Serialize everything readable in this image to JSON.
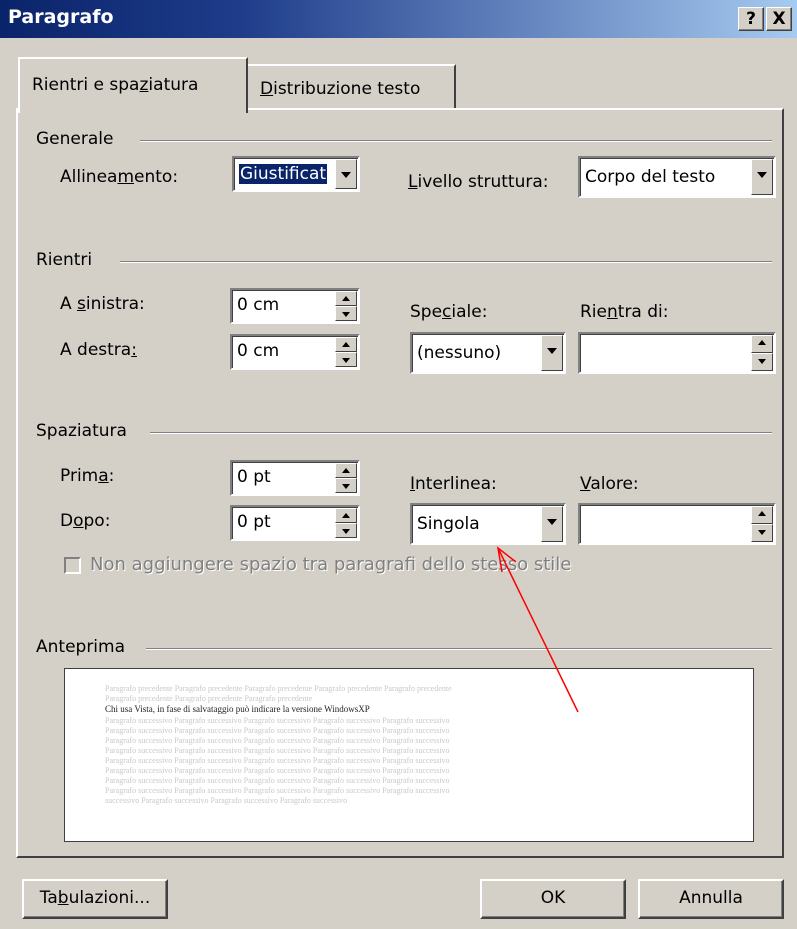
{
  "window": {
    "title": "Paragrafo",
    "help_label": "?",
    "close_label": "X"
  },
  "tabs": [
    {
      "label_pre": "Rientri e spa",
      "label_key": "z",
      "label_post": "iatura",
      "active": true
    },
    {
      "label_pre": "",
      "label_key": "D",
      "label_post": "istribuzione testo",
      "active": false
    }
  ],
  "generale": {
    "group_label": "Generale",
    "alignment_label_pre": "Allinea",
    "alignment_label_key": "m",
    "alignment_label_post": "ento:",
    "alignment_value": "Giustificat",
    "outline_label_pre": "",
    "outline_label_key": "L",
    "outline_label_post": "ivello struttura:",
    "outline_value": "Corpo del testo"
  },
  "rientri": {
    "group_label": "Rientri",
    "left_label_pre": "A ",
    "left_label_key": "s",
    "left_label_post": "inistra:",
    "left_value": "0 cm",
    "right_label_pre": "A destra",
    "right_label_key": ":",
    "right_label_post": "",
    "right_value": "0 cm",
    "special_label_pre": "Spe",
    "special_label_key": "c",
    "special_label_post": "iale:",
    "special_value": "(nessuno)",
    "by_label_pre": "Rie",
    "by_label_key": "n",
    "by_label_post": "tra di:",
    "by_value": ""
  },
  "spaziatura": {
    "group_label": "Spaziatura",
    "before_label_pre": "Prim",
    "before_label_key": "a",
    "before_label_post": ":",
    "before_value": "0 pt",
    "after_label_pre": "D",
    "after_label_key": "o",
    "after_label_post": "po:",
    "after_value": "0 pt",
    "line_label_pre": "",
    "line_label_key": "I",
    "line_label_post": "nterlinea:",
    "line_value": "Singola",
    "at_label_pre": "",
    "at_label_key": "V",
    "at_label_post": "alore:",
    "at_value": "",
    "no_space_label": "Non aggiungere spazio tra paragrafi dello stesso stile"
  },
  "anteprima": {
    "group_label": "Anteprima",
    "prev_text_1": "Paragrafo precedente Paragrafo precedente Paragrafo precedente Paragrafo precedente Paragrafo precedente",
    "prev_text_2": "Paragrafo precedente Paragrafo precedente Paragrafo precedente",
    "main_text": "Chi usa Vista, in fase di salvataggio può indicare la versione WindowsXP",
    "next_text": "Paragrafo successivo Paragrafo successivo Paragrafo successivo Paragrafo successivo Paragrafo successivo",
    "next_text_last": "successivo Paragrafo successivo Paragrafo successivo Paragrafo successivo"
  },
  "buttons": {
    "tabs_pre": "Ta",
    "tabs_key": "b",
    "tabs_post": "ulazioni...",
    "ok_label": "OK",
    "cancel_label": "Annulla"
  },
  "colors": {
    "title_start": "#0a246a",
    "title_end": "#a6caf0",
    "face": "#d4d0c8",
    "selection": "#0a246a",
    "arrow": "#ff0000"
  }
}
